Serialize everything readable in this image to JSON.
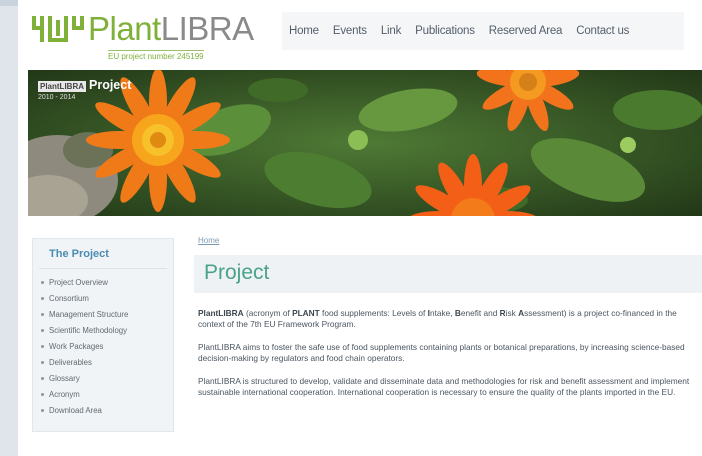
{
  "header": {
    "logo_name_1": "Plant",
    "logo_name_2": "LIBRA",
    "logo_tagline": "EU project number 245199"
  },
  "nav": {
    "items": [
      "Home",
      "Events",
      "Link",
      "Publications",
      "Reserved Area",
      "Contact us"
    ]
  },
  "banner": {
    "tag": "PlantLIBRA",
    "title": "Project",
    "sub": "2010 - 2014"
  },
  "sidebar": {
    "title": "The Project",
    "items": [
      "Project Overview",
      "Consortium",
      "Management Structure",
      "Scientific Methodology",
      "Work Packages",
      "Deliverables",
      "Glossary",
      "Acronym",
      "Download Area"
    ]
  },
  "main": {
    "breadcrumb": "Home",
    "title": "Project",
    "p1_a": "PlantLIBRA",
    "p1_b": " (acronym of ",
    "p1_c": "PLANT",
    "p1_d": " food supplements: Levels of ",
    "p1_e": "I",
    "p1_f": "ntake, ",
    "p1_g": "B",
    "p1_h": "enefit and ",
    "p1_i": "R",
    "p1_j": "isk ",
    "p1_k": "A",
    "p1_l": "ssessment) is a project co-financed in the context of the 7th EU Framework Program.",
    "p2": "PlantLIBRA aims to foster the safe use of food supplements containing plants or botanical preparations, by increasing science-based decision-making by regulators and food chain operators.",
    "p3": "PlantLIBRA is structured to develop, validate and disseminate data and methodologies for risk and benefit assessment and implement sustainable international cooperation. International cooperation is necessary to ensure the quality of the plants imported in the EU."
  },
  "colors": {
    "brand_green": "#7fb13a",
    "title_teal": "#4aa28a",
    "sidebar_title_blue": "#4a8bb3"
  }
}
